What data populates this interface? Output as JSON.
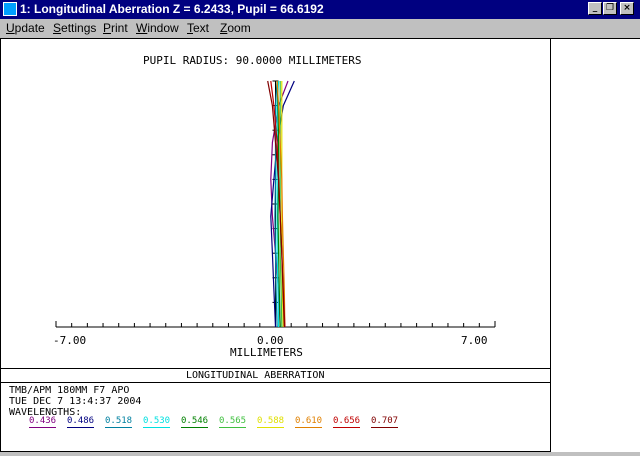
{
  "window": {
    "title": "1: Longitudinal Aberration Z = 6.2433, Pupil = 66.6192",
    "icon": "app-icon",
    "buttons": {
      "minimize": "_",
      "restore": "❐",
      "close": "×"
    }
  },
  "menu": {
    "items": [
      {
        "key": "U",
        "rest": "pdate"
      },
      {
        "key": "S",
        "rest": "ettings"
      },
      {
        "key": "P",
        "rest": "rint"
      },
      {
        "key": "W",
        "rest": "indow"
      },
      {
        "key": "T",
        "rest": "ext"
      },
      {
        "key": "Z",
        "rest": "oom"
      }
    ]
  },
  "plot": {
    "pupil_label": "PUPIL RADIUS: 90.0000 MILLIMETERS",
    "x_min_label": "-7.00",
    "x_mid_label": "0.00",
    "x_max_label": "7.00",
    "x_axis_label": "MILLIMETERS",
    "section_title": "LONGITUDINAL ABERRATION",
    "lens_name": "TMB/APM 180MM F7 APO",
    "date": "TUE DEC 7 13:4:37 2004",
    "wavelengths_label": "WAVELENGTHS:"
  },
  "chart_data": {
    "type": "line",
    "xlim": [
      -7,
      7
    ],
    "ylim": [
      0,
      1
    ],
    "xlabel": "MILLIMETERS",
    "series": [
      {
        "name": "0.436",
        "color": "#800080",
        "x": [
          0.15,
          0.1,
          0.0,
          -0.1,
          -0.15,
          -0.1,
          0.1,
          0.4
        ],
        "y": [
          0,
          0.15,
          0.3,
          0.45,
          0.6,
          0.75,
          0.9,
          1.0
        ]
      },
      {
        "name": "0.486",
        "color": "#000080",
        "x": [
          0.0,
          -0.05,
          -0.1,
          -0.15,
          -0.05,
          0.05,
          0.25,
          0.6
        ],
        "y": [
          0,
          0.15,
          0.3,
          0.45,
          0.6,
          0.75,
          0.9,
          1.0
        ]
      },
      {
        "name": "0.518",
        "color": "#0080a0",
        "x": [
          0.05,
          0.02,
          0.0,
          -0.02,
          0.0,
          0.0,
          0.0,
          0.05
        ],
        "y": [
          0,
          0.15,
          0.3,
          0.45,
          0.6,
          0.75,
          0.9,
          1.0
        ]
      },
      {
        "name": "0.530",
        "color": "#00e0e0",
        "x": [
          0.1,
          0.08,
          0.05,
          0.05,
          0.05,
          0.05,
          0.05,
          0.1
        ],
        "y": [
          0,
          0.15,
          0.3,
          0.45,
          0.6,
          0.75,
          0.9,
          1.0
        ]
      },
      {
        "name": "0.546",
        "color": "#008000",
        "x": [
          0.15,
          0.12,
          0.1,
          0.08,
          0.1,
          0.1,
          0.08,
          0.05
        ],
        "y": [
          0,
          0.15,
          0.3,
          0.45,
          0.6,
          0.75,
          0.9,
          1.0
        ]
      },
      {
        "name": "0.565",
        "color": "#40c040",
        "x": [
          0.2,
          0.18,
          0.15,
          0.15,
          0.15,
          0.15,
          0.15,
          0.15
        ],
        "y": [
          0,
          0.15,
          0.3,
          0.45,
          0.6,
          0.75,
          0.9,
          1.0
        ]
      },
      {
        "name": "0.588",
        "color": "#e0e000",
        "x": [
          0.25,
          0.22,
          0.2,
          0.2,
          0.2,
          0.2,
          0.2,
          0.2
        ],
        "y": [
          0,
          0.15,
          0.3,
          0.45,
          0.6,
          0.75,
          0.9,
          1.0
        ]
      },
      {
        "name": "0.610",
        "color": "#e08000",
        "x": [
          0.3,
          0.28,
          0.25,
          0.22,
          0.2,
          0.15,
          0.1,
          0.05
        ],
        "y": [
          0,
          0.15,
          0.3,
          0.45,
          0.6,
          0.75,
          0.9,
          1.0
        ]
      },
      {
        "name": "0.656",
        "color": "#c00000",
        "x": [
          0.3,
          0.25,
          0.2,
          0.15,
          0.1,
          0.05,
          -0.05,
          -0.15
        ],
        "y": [
          0,
          0.15,
          0.3,
          0.45,
          0.6,
          0.75,
          0.9,
          1.0
        ]
      },
      {
        "name": "0.707",
        "color": "#800000",
        "x": [
          0.28,
          0.24,
          0.2,
          0.15,
          0.1,
          0.0,
          -0.1,
          -0.25
        ],
        "y": [
          0,
          0.15,
          0.3,
          0.45,
          0.6,
          0.75,
          0.9,
          1.0
        ]
      }
    ],
    "grid": false
  }
}
